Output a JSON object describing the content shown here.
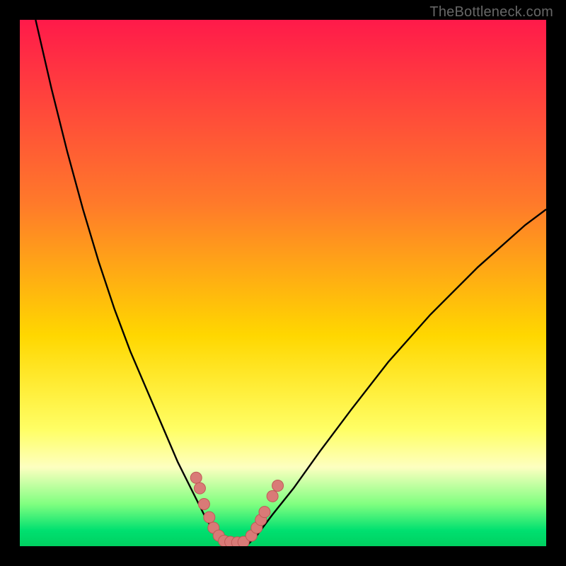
{
  "watermark": "TheBottleneck.com",
  "chart_data": {
    "type": "line",
    "title": "",
    "xlabel": "",
    "ylabel": "",
    "xlim": [
      0,
      100
    ],
    "ylim": [
      0,
      100
    ],
    "gradient_stops": [
      {
        "offset": 0,
        "color": "#ff1a4a"
      },
      {
        "offset": 35,
        "color": "#ff7a2a"
      },
      {
        "offset": 60,
        "color": "#ffd700"
      },
      {
        "offset": 78,
        "color": "#ffff66"
      },
      {
        "offset": 85,
        "color": "#fdffc0"
      },
      {
        "offset": 92,
        "color": "#80ff80"
      },
      {
        "offset": 97,
        "color": "#00e070"
      },
      {
        "offset": 100,
        "color": "#00d060"
      }
    ],
    "series": [
      {
        "name": "left-curve",
        "x": [
          3,
          6,
          9,
          12,
          15,
          18,
          21,
          24,
          27,
          30,
          33,
          35.5,
          37.5,
          39
        ],
        "y": [
          100,
          87,
          75,
          64,
          54,
          45,
          37,
          30,
          23,
          16,
          10,
          5,
          2,
          0
        ]
      },
      {
        "name": "right-curve",
        "x": [
          43,
          45,
          48,
          52,
          57,
          63,
          70,
          78,
          87,
          96,
          100
        ],
        "y": [
          0,
          2,
          6,
          11,
          18,
          26,
          35,
          44,
          53,
          61,
          64
        ]
      }
    ],
    "flat_bottom": {
      "x0": 39,
      "x1": 43,
      "y": 0
    },
    "markers": [
      {
        "name": "left-cluster",
        "points": [
          {
            "x": 33.5,
            "y": 13
          },
          {
            "x": 34.2,
            "y": 11
          },
          {
            "x": 35.0,
            "y": 8
          },
          {
            "x": 36.0,
            "y": 5.5
          },
          {
            "x": 36.8,
            "y": 3.5
          },
          {
            "x": 37.8,
            "y": 2
          },
          {
            "x": 38.8,
            "y": 1
          },
          {
            "x": 40.0,
            "y": 0.8
          },
          {
            "x": 41.3,
            "y": 0.7
          },
          {
            "x": 42.5,
            "y": 0.8
          }
        ]
      },
      {
        "name": "right-cluster",
        "points": [
          {
            "x": 44.0,
            "y": 2.0
          },
          {
            "x": 45.0,
            "y": 3.5
          },
          {
            "x": 45.8,
            "y": 5.0
          },
          {
            "x": 46.5,
            "y": 6.5
          },
          {
            "x": 48.0,
            "y": 9.5
          },
          {
            "x": 49.0,
            "y": 11.5
          }
        ]
      }
    ],
    "marker_style": {
      "r": 8,
      "fill": "#d97a77",
      "stroke": "#c05a57"
    }
  }
}
